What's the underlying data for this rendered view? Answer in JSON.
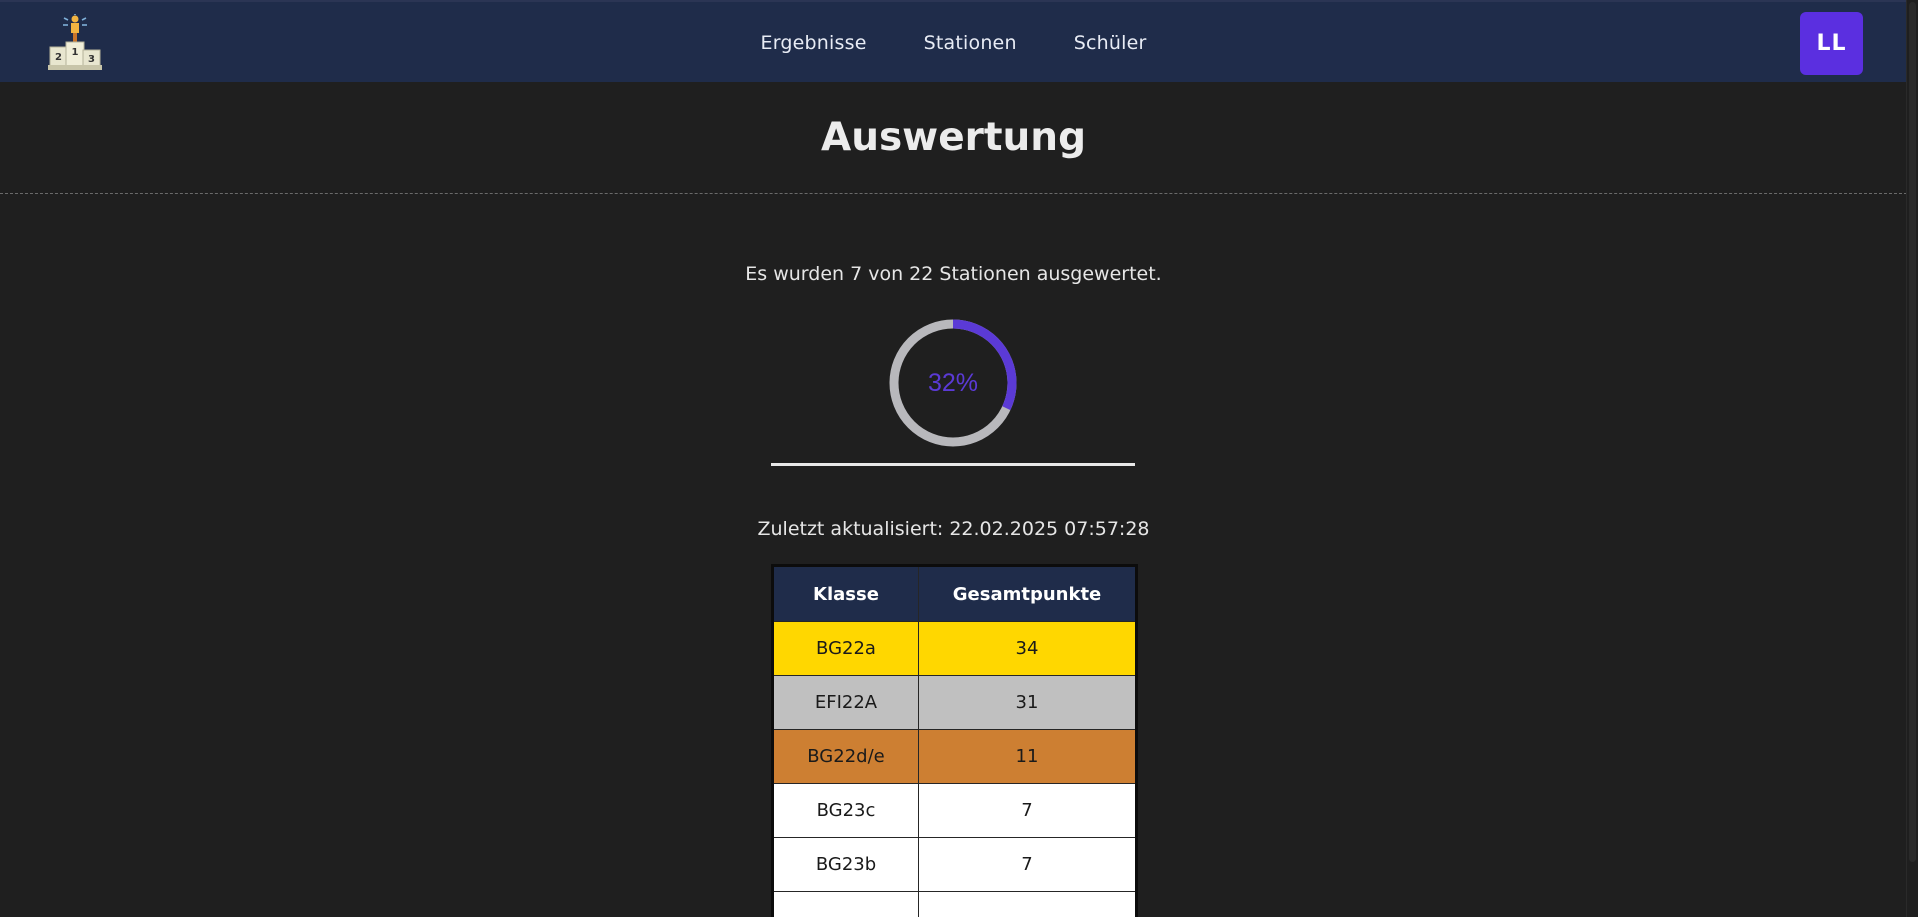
{
  "header": {
    "logo_icon": "podium-icon",
    "nav": [
      {
        "label": "Ergebnisse"
      },
      {
        "label": "Stationen"
      },
      {
        "label": "Schüler"
      }
    ],
    "avatar_initials": "LL"
  },
  "main": {
    "title": "Auswertung",
    "evaluation_text": "Es wurden 7 von 22 Stationen ausgewertet.",
    "progress": {
      "evaluated": 7,
      "total": 22,
      "percent_label": "32%",
      "fraction": 0.32,
      "fill_color": "#5b3ad6",
      "track_color": "#b8b8bc"
    },
    "last_updated": "Zuletzt aktualisiert: 22.02.2025 07:57:28",
    "table": {
      "headers": [
        "Klasse",
        "Gesamtpunkte"
      ],
      "rows": [
        {
          "klasse": "BG22a",
          "punkte": "34",
          "color": "#ffd700"
        },
        {
          "klasse": "EFI22A",
          "punkte": "31",
          "color": "#c0c0c0"
        },
        {
          "klasse": "BG22d/e",
          "punkte": "11",
          "color": "#cd7f32"
        },
        {
          "klasse": "BG23c",
          "punkte": "7",
          "color": "#ffffff"
        },
        {
          "klasse": "BG23b",
          "punkte": "7",
          "color": "#ffffff"
        },
        {
          "klasse": "",
          "punkte": "",
          "color": "#ffffff"
        }
      ]
    }
  },
  "colors": {
    "header_bg": "#1f2c4a",
    "page_bg": "#1f1f1f",
    "accent": "#5b2fe0"
  }
}
